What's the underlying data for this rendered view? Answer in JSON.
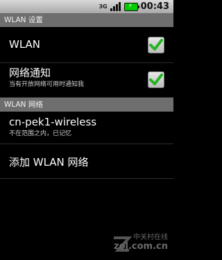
{
  "status_bar": {
    "network": "3G",
    "time": "00:43",
    "colors": {
      "background": "#bdbdbd",
      "battery": "#00cc00"
    }
  },
  "wlan_settings_header": "WLAN 设置",
  "wlan_toggle": {
    "label": "WLAN",
    "checked": true
  },
  "network_notify": {
    "label": "网络通知",
    "summary": "当有开放网络可用时通知我",
    "checked": true
  },
  "wlan_networks_header": "WLAN 网络",
  "network_entry": {
    "ssid": "cn-pek1-wireless",
    "status": "不在范围之内，已记忆"
  },
  "add_network": {
    "label": "添加 WLAN 网络"
  },
  "watermark": {
    "brand": "中关村在线",
    "site": "zol.com.cn"
  },
  "icons": [
    "3g-icon",
    "signal-icon",
    "battery-icon",
    "checkbox-check-icon",
    "zol-logo-icon"
  ]
}
